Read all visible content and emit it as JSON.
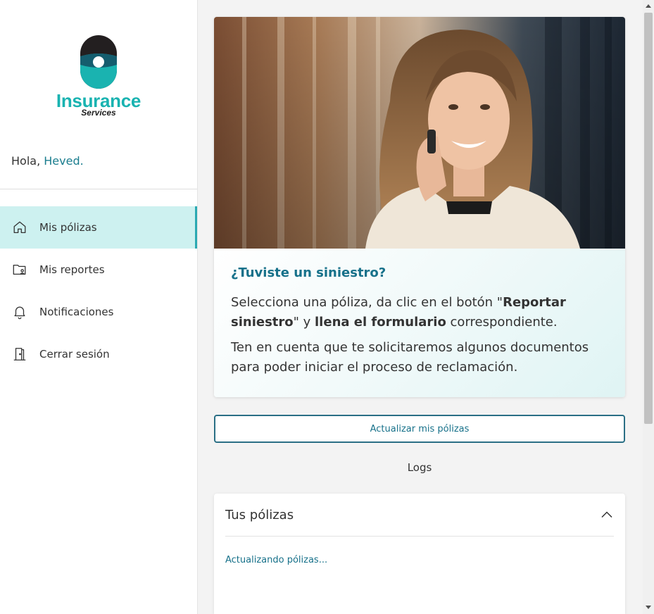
{
  "brand": {
    "name": "Insurance",
    "tagline": "Services",
    "colors": {
      "accent": "#19b3b1",
      "dark": "#1d1d1d",
      "primary": "#17718a",
      "active_bg": "#cdf1f0"
    }
  },
  "greeting": {
    "prefix": "Hola, ",
    "user": "Heved."
  },
  "nav": {
    "items": [
      {
        "label": "Mis pólizas",
        "icon": "home-icon",
        "active": true
      },
      {
        "label": "Mis reportes",
        "icon": "folder-user-icon",
        "active": false
      },
      {
        "label": "Notificaciones",
        "icon": "bell-icon",
        "active": false
      },
      {
        "label": "Cerrar sesión",
        "icon": "door-exit-icon",
        "active": false
      }
    ]
  },
  "hero": {
    "title": "¿Tuviste un siniestro?",
    "p1_part1": "Selecciona una póliza, da clic en el botón \"",
    "p1_bold1": "Reportar siniestro",
    "p1_part2": "\" y ",
    "p1_bold2": "llena el formulario",
    "p1_part3": " correspondiente.",
    "p2": "Ten en cuenta que te solicitaremos algunos documentos para poder iniciar el proceso de reclamación."
  },
  "actions": {
    "update_label": "Actualizar mis pólizas",
    "logs_label": "Logs"
  },
  "policies": {
    "title": "Tus pólizas",
    "status": "Actualizando pólizas...",
    "expand_icon": "chevron-up-icon"
  }
}
